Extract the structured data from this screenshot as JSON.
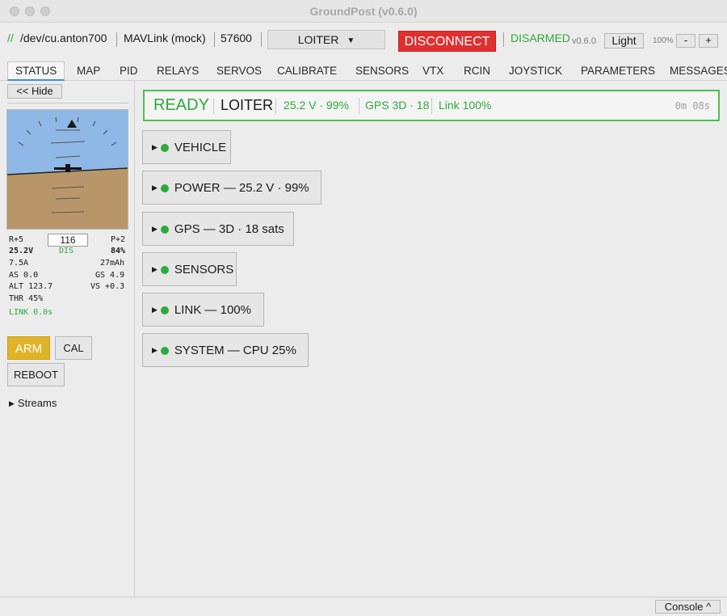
{
  "window": {
    "title": "GroundPost (v0.6.0)"
  },
  "toolbar": {
    "port_prefix": "//",
    "port": "/dev/cu.anton700",
    "protocol": "MAVLink (mock)",
    "baud": "57600",
    "mode_value": "LOITER",
    "disconnect_label": "DISCONNECT",
    "arm_state": "DISARMED",
    "version": "v0.6.0",
    "theme_label": "Light",
    "zoom": "100%",
    "zoom_out_label": "-",
    "zoom_in_label": "+"
  },
  "tabs": [
    "STATUS",
    "MAP",
    "PID",
    "RELAYS",
    "SERVOS",
    "CALIBRATE",
    "SENSORS",
    "VTX",
    "RCIN",
    "JOYSTICK",
    "PARAMETERS",
    "MESSAGES"
  ],
  "left_panel": {
    "hide_label": "<< Hide",
    "heading": "116",
    "roll": "R+5",
    "pitch": "P+2",
    "voltage": "25.2V",
    "disarm_short": "DIS",
    "battery_pct": "84%",
    "current": "7.5A",
    "consumed": "27mAh",
    "airspeed": "AS 0.0",
    "groundspeed": "GS 4.9",
    "altitude": "ALT 123.7",
    "vspeed": "VS +0.3",
    "throttle": "THR 45%",
    "link": "LINK  0.0s",
    "arm_label": "ARM",
    "cal_label": "CAL",
    "reboot_label": "REBOOT",
    "streams_label": "Streams",
    "colors": {
      "sky": "#8fb8e6",
      "ground": "#b8966a",
      "arm": "#e0b428"
    }
  },
  "status": {
    "state": "READY",
    "mode": "LOITER",
    "battery": "25.2 V · 99%",
    "gps": "GPS 3D · 18",
    "link": "Link 100%",
    "elapsed": "0m 08s",
    "accent": "#2eaa3a"
  },
  "sections": [
    {
      "label": "VEHICLE"
    },
    {
      "label": "POWER  —  25.2 V · 99%"
    },
    {
      "label": "GPS  —  3D · 18 sats"
    },
    {
      "label": "SENSORS"
    },
    {
      "label": "LINK  —  100%"
    },
    {
      "label": "SYSTEM  —  CPU 25%"
    }
  ],
  "statusbar": {
    "console_label": "Console ^"
  }
}
